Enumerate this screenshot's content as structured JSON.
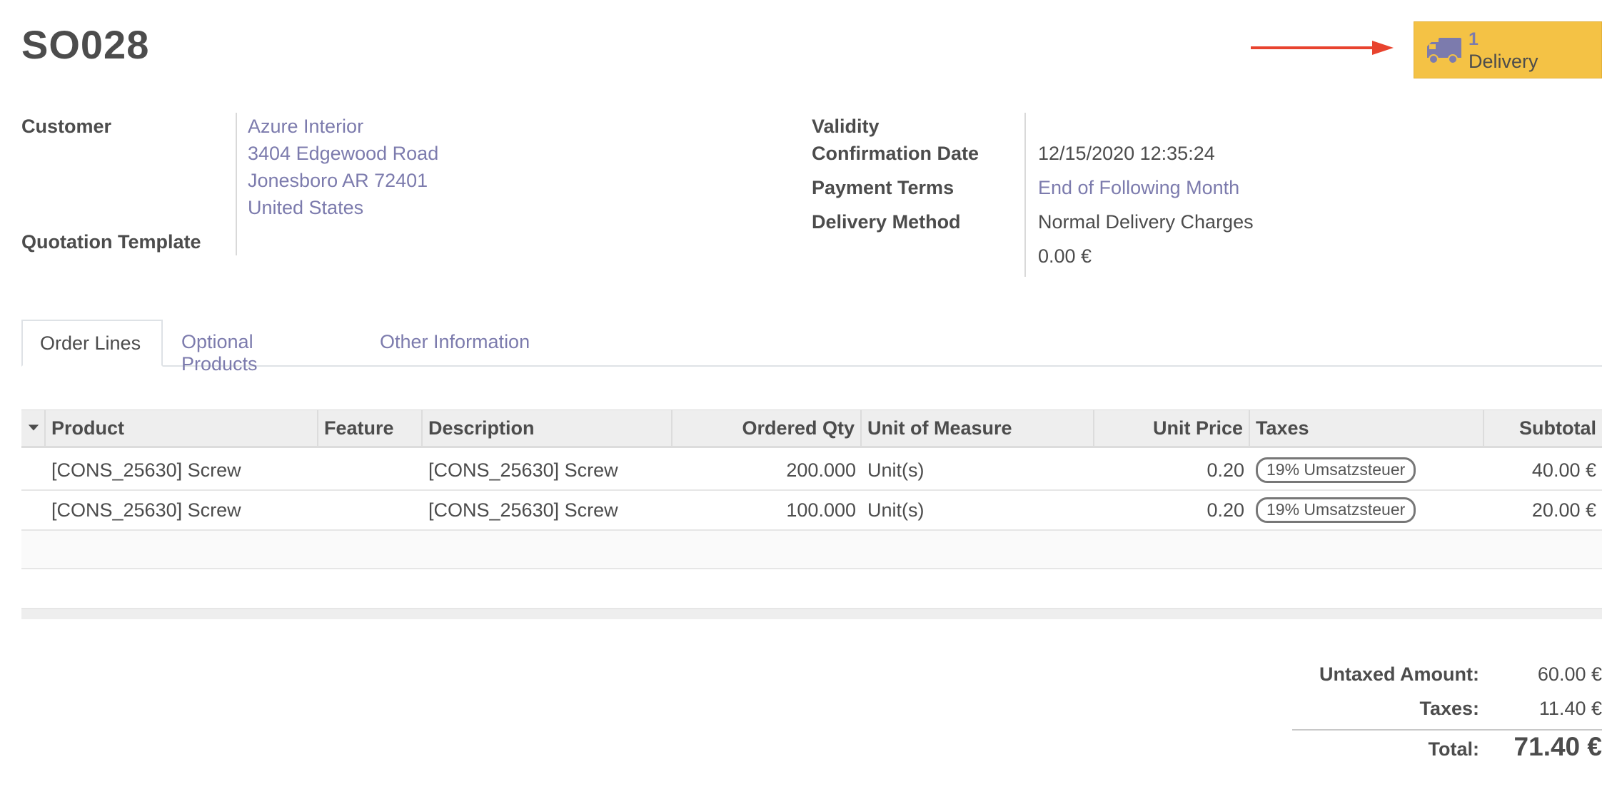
{
  "record": {
    "title": "SO028"
  },
  "smart_button": {
    "count": "1",
    "label": "Delivery",
    "icon": "truck-icon"
  },
  "fields_left": {
    "customer_label": "Customer",
    "customer_name": "Azure Interior",
    "address_line1": "3404 Edgewood Road",
    "address_line2": "Jonesboro AR 72401",
    "address_line3": "United States",
    "template_label": "Quotation Template"
  },
  "fields_right": {
    "validity_label": "Validity",
    "confirmation_label": "Confirmation Date",
    "confirmation_value": "12/15/2020 12:35:24",
    "payment_label": "Payment Terms",
    "payment_value": "End of Following Month",
    "delivery_label": "Delivery Method",
    "delivery_value": "Normal Delivery Charges",
    "delivery_cost": "0.00 €"
  },
  "tabs": [
    {
      "label": "Order Lines",
      "active": true
    },
    {
      "label": "Optional Products",
      "active": false
    },
    {
      "label": "Other Information",
      "active": false
    }
  ],
  "table": {
    "headers": {
      "product": "Product",
      "feature": "Feature",
      "description": "Description",
      "qty": "Ordered Qty",
      "uom": "Unit of Measure",
      "price": "Unit Price",
      "taxes": "Taxes",
      "subtotal": "Subtotal"
    },
    "rows": [
      {
        "product": "[CONS_25630] Screw",
        "feature": "",
        "description": "[CONS_25630] Screw",
        "qty": "200.000",
        "uom": "Unit(s)",
        "price": "0.20",
        "taxes": "19% Umsatzsteuer",
        "subtotal": "40.00 €"
      },
      {
        "product": "[CONS_25630] Screw",
        "feature": "",
        "description": "[CONS_25630] Screw",
        "qty": "100.000",
        "uom": "Unit(s)",
        "price": "0.20",
        "taxes": "19% Umsatzsteuer",
        "subtotal": "20.00 €"
      }
    ]
  },
  "totals": {
    "untaxed_label": "Untaxed Amount:",
    "untaxed_value": "60.00 €",
    "taxes_label": "Taxes:",
    "taxes_value": "11.40 €",
    "total_label": "Total:",
    "total_value": "71.40 €"
  },
  "colors": {
    "accent": "#7c7bad",
    "button": "#f4c245",
    "arrow": "#e8432e"
  }
}
